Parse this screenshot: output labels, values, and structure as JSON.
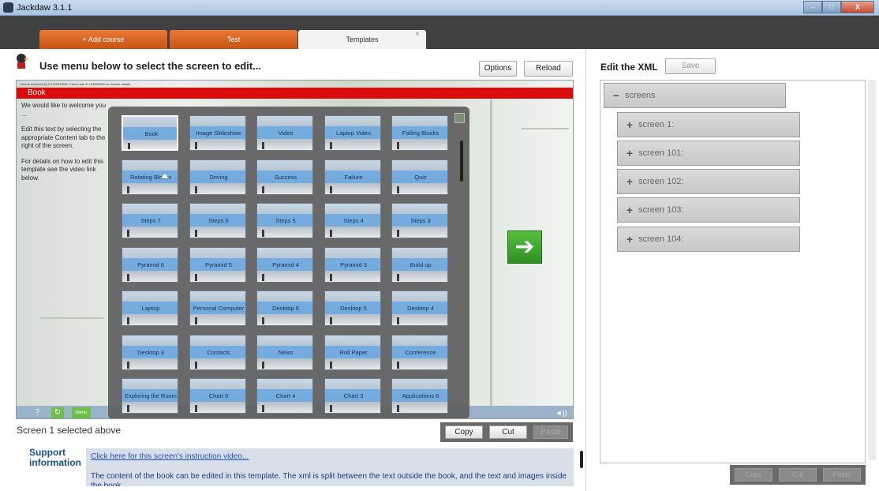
{
  "window": {
    "title": "Jackdaw 3.1.1",
    "minimize": "–",
    "maximize": "□",
    "close": "X"
  },
  "tabs": [
    {
      "label": "+ Add course"
    },
    {
      "label": "Test"
    },
    {
      "label": "Templates",
      "close": "×"
    }
  ],
  "left": {
    "menu_title": "Use menu below to select the screen to edit...",
    "options_label": "Options",
    "reload_label": "Reload",
    "license_text": "Course authored by E-LEARNING, Check with E-LEARNING for license details.",
    "book_title": "Book",
    "intro": [
      "We would like to welcome you ...",
      "Edit this text by selecting the appropriate Content tab to the right of the screen.",
      "For details on how to edit this template see the video link below."
    ],
    "bottom_help": "?",
    "bottom_refresh": "↻",
    "bottom_menu": "menu",
    "bottom_audio": "◄))",
    "next_arrow": "➔",
    "templates": [
      "Book",
      "Image Slideshow",
      "Video",
      "Laptop Video",
      "Falling Blocks",
      "Rotating Blocks",
      "Driving",
      "Success",
      "Failure",
      "Quiz",
      "Steps 7",
      "Steps 6",
      "Steps 5",
      "Steps 4",
      "Steps 3",
      "Pyramid 6",
      "Pyramid 5",
      "Pyramid 4",
      "Pyramid 3",
      "Build up",
      "Laptop",
      "Personal Computer",
      "Desktop 6",
      "Desktop 5",
      "Desktop 4",
      "Desktop 3",
      "Contacts",
      "News",
      "Roll Paper",
      "Conference",
      "Exploring the Room",
      "Chart 5",
      "Chart 4",
      "Chart 3",
      "Applications 6"
    ],
    "status_text": "Screen 1 selected above",
    "copy_label": "Copy",
    "cut_label": "Cut",
    "paste_label": "Paste"
  },
  "support": {
    "label": "Support information",
    "link_text": "Click here for this screen's instruction video...",
    "description": "The content of the book can be edited in this template. The xml is split between the text outside the book, and the text and images inside the book."
  },
  "xml": {
    "title": "Edit the XML",
    "save_label": "Save",
    "root": {
      "label": "screens",
      "symbol": "−"
    },
    "nodes": [
      {
        "label": "screen 1:",
        "symbol": "+"
      },
      {
        "label": "screen 101:",
        "symbol": "+"
      },
      {
        "label": "screen 102:",
        "symbol": "+"
      },
      {
        "label": "screen 103:",
        "symbol": "+"
      },
      {
        "label": "screen 104:",
        "symbol": "+"
      }
    ],
    "copy_label": "Copy",
    "cut_label": "Cut",
    "paste_label": "Paste"
  },
  "colors": {
    "accent_orange": "#d9621e",
    "book_red": "#d90b0b",
    "link_blue": "#1f51c4",
    "next_green": "#3faa2c"
  }
}
